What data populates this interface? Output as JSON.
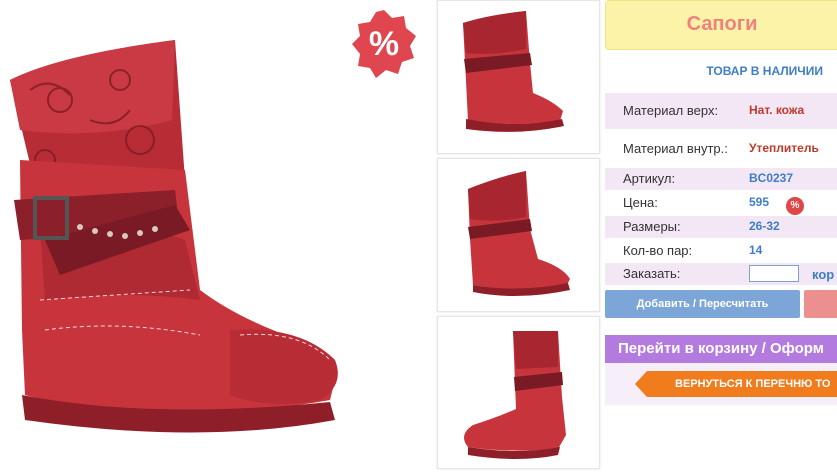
{
  "product": {
    "title": "Сапоги",
    "stock_status": "ТОВАР В НАЛИЧИИ",
    "sale_badge": "%"
  },
  "specs": {
    "material_top_label": "Материал верх:",
    "material_top_value": "Нат. кожа",
    "material_inner_label": "Материал внутр.:",
    "material_inner_value": "Утеплитель",
    "article_label": "Артикул:",
    "article_value": "BC0237",
    "price_label": "Цена:",
    "price_value": "595",
    "price_badge": "%",
    "sizes_label": "Размеры:",
    "sizes_value": "26-32",
    "pairs_label": "Кол-во пар:",
    "pairs_value": "14",
    "order_label": "Заказать:",
    "order_value": "",
    "order_unit": "кор"
  },
  "actions": {
    "add_label": "Добавить / Пересчитать",
    "cart_label": "Перейти в корзину / Оформ",
    "back_label": "ВЕРНУТЬСЯ К ПЕРЕЧНЮ ТО"
  },
  "colors": {
    "boot_red": "#c8343c",
    "title_bg": "#fdf3a8",
    "accent_blue": "#3d7ec8",
    "purple": "#b37be0",
    "orange": "#f07c1e"
  }
}
